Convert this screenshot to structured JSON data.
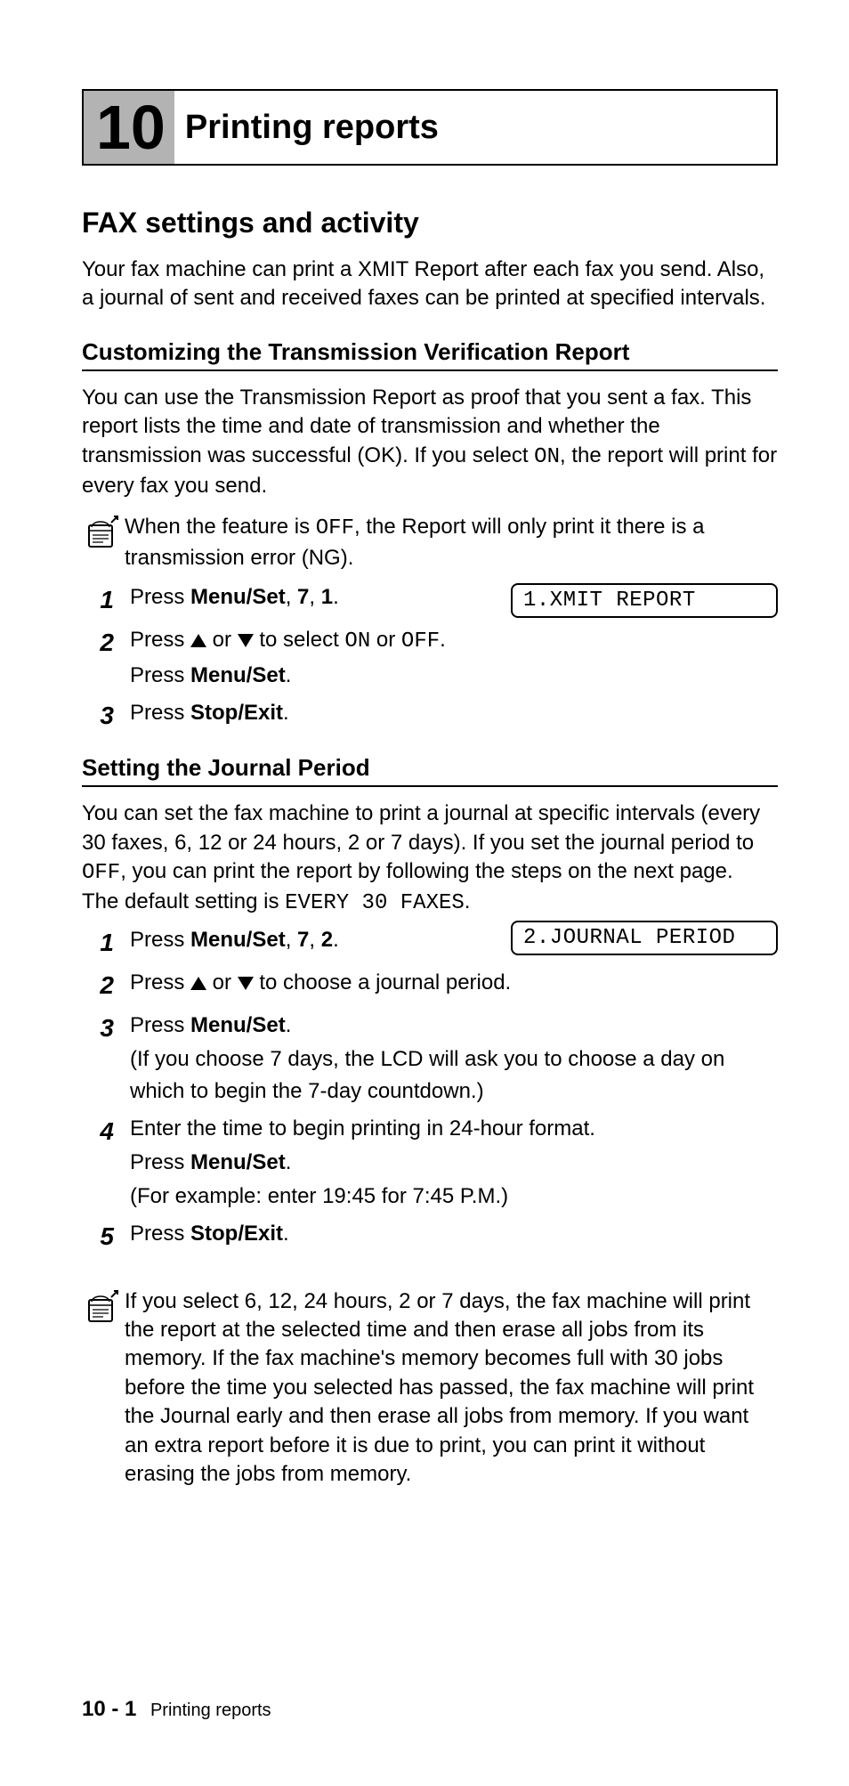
{
  "chapter": {
    "number": "10",
    "title": "Printing reports"
  },
  "section1": {
    "heading": "FAX settings and activity",
    "intro": "Your fax machine can print a XMIT Report after each fax you send. Also, a journal of sent and received faxes can be printed at specified intervals."
  },
  "sub1": {
    "heading": "Customizing the Transmission Verification Report",
    "para_a": "You can use the Transmission Report as proof that you sent a fax. This report lists the time and date of transmission and whether the transmission was successful (OK). If you select ",
    "para_on": "ON",
    "para_b": ", the report will print for every fax you send.",
    "note_a": "When the feature is ",
    "note_off": "OFF",
    "note_b": ", the Report will only print it there is a transmission error (NG).",
    "lcd": "1.XMIT REPORT",
    "steps": {
      "s1_a": "Press ",
      "s1_b": "Menu/Set",
      "s1_c": ", ",
      "s1_d": "7",
      "s1_e": ", ",
      "s1_f": "1",
      "s1_g": ".",
      "s2_a": "Press ",
      "s2_b": " or ",
      "s2_c": " to select ",
      "s2_on": "ON",
      "s2_d": " or ",
      "s2_off": "OFF",
      "s2_e": ".",
      "s2_sub_a": "Press ",
      "s2_sub_b": "Menu/Set",
      "s2_sub_c": ".",
      "s3_a": "Press ",
      "s3_b": "Stop/Exit",
      "s3_c": "."
    }
  },
  "sub2": {
    "heading": "Setting the Journal Period",
    "para_a": "You can set the fax machine to print a journal at specific intervals (every 30 faxes, 6, 12 or 24 hours, 2 or 7 days). If you set the journal period to ",
    "para_off": "OFF",
    "para_b": ", you can print the report by following the steps on the next page.",
    "default_a": "The default setting is ",
    "default_val": "EVERY 30 FAXES",
    "default_b": ".",
    "lcd": "2.JOURNAL PERIOD",
    "steps": {
      "s1_a": "Press ",
      "s1_b": "Menu/Set",
      "s1_c": ", ",
      "s1_d": "7",
      "s1_e": ", ",
      "s1_f": "2",
      "s1_g": ".",
      "s2_a": "Press ",
      "s2_b": " or ",
      "s2_c": " to choose a journal period.",
      "s3_a": "Press ",
      "s3_b": "Menu/Set",
      "s3_c": ".",
      "s3_sub": "(If you choose 7 days, the LCD will ask you to choose a day on which to begin the 7-day countdown.)",
      "s4_a": "Enter the time to begin printing in 24-hour format.",
      "s4_sub1_a": "Press ",
      "s4_sub1_b": "Menu/Set",
      "s4_sub1_c": ".",
      "s4_sub2": "(For example: enter 19:45 for 7:45 P.M.)",
      "s5_a": "Press ",
      "s5_b": "Stop/Exit",
      "s5_c": "."
    },
    "note": "If you select 6, 12, 24 hours, 2 or 7 days, the fax machine will print the report at the selected time and then erase all jobs from its memory. If the fax machine's memory becomes full with 30 jobs before the time you selected has passed, the fax machine will print the Journal early and then erase all jobs from memory. If you want an extra report before it is due to print, you can print it without erasing the jobs from memory."
  },
  "footer": {
    "pagenum": "10 - 1",
    "title": "Printing reports"
  }
}
